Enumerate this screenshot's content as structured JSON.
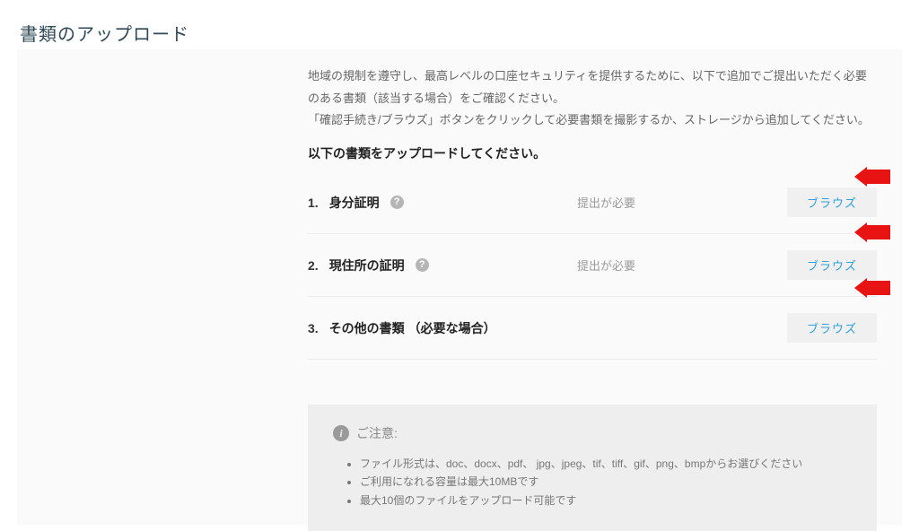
{
  "page_title": "書類のアップロード",
  "intro": {
    "line1": "地域の規制を遵守し、最高レベルの口座セキュリティを提供するために、以下で追加でご提出いただく必要のある書類（該当する場合）をご確認ください。",
    "line2": "「確認手続き/ブラウズ」ボタンをクリックして必要書類を撮影するか、ストレージから追加してください。"
  },
  "section_heading": "以下の書類をアップロードしてください。",
  "docs": [
    {
      "num": "1.",
      "label": "身分証明",
      "help": true,
      "status": "提出が必要",
      "browse": "ブラウズ"
    },
    {
      "num": "2.",
      "label": "現住所の証明",
      "help": true,
      "status": "提出が必要",
      "browse": "ブラウズ"
    },
    {
      "num": "3.",
      "label": "その他の書類 （必要な場合）",
      "help": false,
      "status": "",
      "browse": "ブラウズ"
    }
  ],
  "notice": {
    "heading": "ご注意:",
    "items": [
      "ファイル形式は、doc、docx、pdf、 jpg、jpeg、tif、tiff、gif、png、bmpからお選びください",
      "ご利用になれる容量は最大10MBです",
      "最大10個のファイルをアップロード可能です"
    ]
  },
  "help_glyph": "?"
}
